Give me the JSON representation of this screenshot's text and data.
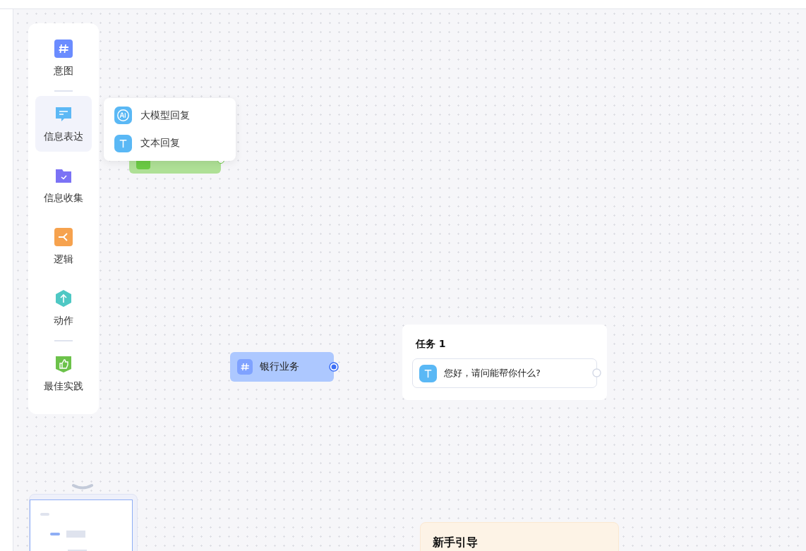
{
  "palette": {
    "items": [
      {
        "kind": "intent",
        "label": "意图",
        "selected": false,
        "divider_after": true
      },
      {
        "kind": "message",
        "label": "信息表达",
        "selected": true,
        "divider_after": false
      },
      {
        "kind": "collect",
        "label": "信息收集",
        "selected": false,
        "divider_after": false
      },
      {
        "kind": "logic",
        "label": "逻辑",
        "selected": false,
        "divider_after": false
      },
      {
        "kind": "action",
        "label": "动作",
        "selected": false,
        "divider_after": true
      },
      {
        "kind": "best",
        "label": "最佳实践",
        "selected": false,
        "divider_after": false
      }
    ]
  },
  "menu": {
    "items": [
      {
        "kind": "ai",
        "label": "大模型回复"
      },
      {
        "kind": "text",
        "label": "文本回复"
      }
    ]
  },
  "intent_node": {
    "label": "银行业务"
  },
  "task_card": {
    "title": "任务 1",
    "message": "您好，请问能帮你什么?"
  },
  "guide_card": {
    "title": "新手引导"
  }
}
